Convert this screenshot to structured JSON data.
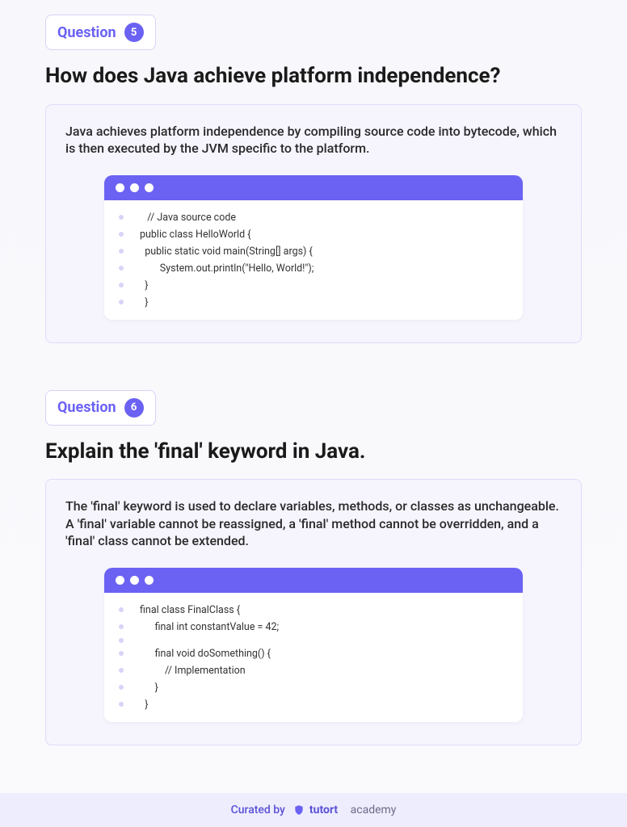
{
  "questions": [
    {
      "label": "Question",
      "number": "5",
      "title": "How does Java achieve platform independence?",
      "answer": "Java achieves platform independence by compiling source code into bytecode, which is then executed by the JVM specific to the platform.",
      "code": [
        "   // Java source code",
        "public class HelloWorld {",
        "  public static void main(String[] args) {",
        "        System.out.println(\"Hello, World!\");",
        "  }",
        "  }"
      ]
    },
    {
      "label": "Question",
      "number": "6",
      "title": "Explain the 'final' keyword in Java.",
      "answer": "The 'final' keyword is used to declare variables, methods, or classes as unchangeable. A 'final' variable cannot be reassigned, a 'final' method cannot be overridden, and a 'final' class cannot be extended.",
      "code": [
        "final class FinalClass {",
        "      final int constantValue = 42;",
        "",
        "      final void doSomething() {",
        "          // Implementation",
        "      }",
        "  }"
      ]
    }
  ],
  "footer": {
    "curated": "Curated by",
    "brand_bold": "tutort",
    "brand_light": "academy"
  }
}
